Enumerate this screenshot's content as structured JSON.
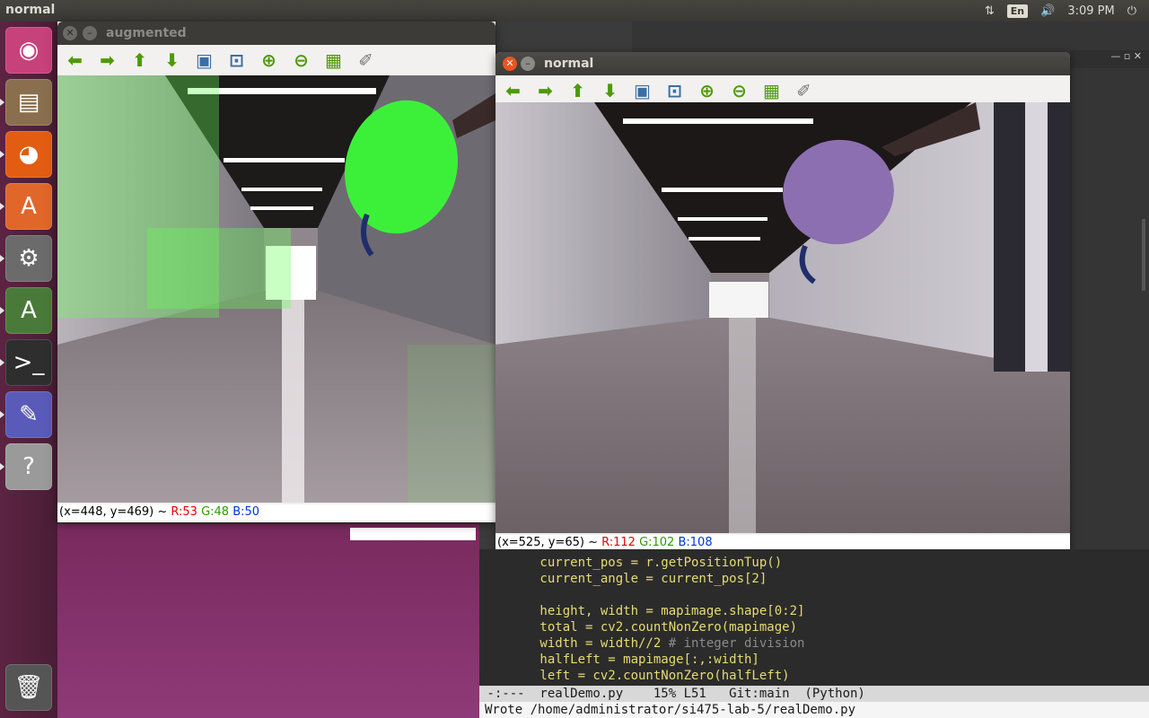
{
  "topbar": {
    "active_app": "normal",
    "lang": "En",
    "time": "3:09 PM",
    "network_icon": "network-arrows-icon",
    "volume_icon": "volume-icon",
    "power_icon": "power-icon"
  },
  "launcher": {
    "items": [
      {
        "name": "ubuntu-dash-icon",
        "glyph": "◉",
        "color": "#c7417a"
      },
      {
        "name": "files-icon",
        "glyph": "▤",
        "color": "#8a6f4e"
      },
      {
        "name": "firefox-icon",
        "glyph": "◕",
        "color": "#e25d12"
      },
      {
        "name": "software-center-icon",
        "glyph": "A",
        "color": "#e0662a"
      },
      {
        "name": "system-settings-icon",
        "glyph": "⚙",
        "color": "#6b6b6b"
      },
      {
        "name": "software-updater-icon",
        "glyph": "A",
        "color": "#4a7a3a"
      },
      {
        "name": "terminal-icon",
        "glyph": ">_",
        "color": "#2e2e2e"
      },
      {
        "name": "text-editor-icon",
        "glyph": "✎",
        "color": "#5a5ab8"
      },
      {
        "name": "help-icon",
        "glyph": "?",
        "color": "#9a9a9a"
      },
      {
        "name": "trash-icon",
        "glyph": "🗑",
        "color": "#555555"
      }
    ]
  },
  "augmented_window": {
    "title": "augmented",
    "status": {
      "coords": "(x=448, y=469) ~ ",
      "r": "R:53",
      "g": "G:48",
      "b": "B:50"
    }
  },
  "normal_window": {
    "title": "normal",
    "status": {
      "coords": "(x=525, y=65) ~ ",
      "r": "R:112",
      "g": "G:102",
      "b": "B:108"
    }
  },
  "toolbar_icons": [
    {
      "name": "pan-left-icon",
      "glyph": "⬅"
    },
    {
      "name": "pan-right-icon",
      "glyph": "➡"
    },
    {
      "name": "pan-up-icon",
      "glyph": "⬆"
    },
    {
      "name": "pan-down-icon",
      "glyph": "⬇"
    },
    {
      "name": "zoom-original-icon",
      "glyph": "▣"
    },
    {
      "name": "zoom-fit-icon",
      "glyph": "⊡"
    },
    {
      "name": "zoom-in-icon",
      "glyph": "⊕"
    },
    {
      "name": "zoom-out-icon",
      "glyph": "⊖"
    },
    {
      "name": "save-icon",
      "glyph": "▦"
    },
    {
      "name": "properties-icon",
      "glyph": "✐"
    }
  ],
  "editor": {
    "lines": [
      "        current_pos = r.getPositionTup()",
      "        current_angle = current_pos[2]",
      "",
      "        height, width = mapimage.shape[0:2]",
      "        total = cv2.countNonZero(mapimage)",
      "        width = width//2 # integer division",
      "        halfLeft = mapimage[:,:width]",
      "        left = cv2.countNonZero(halfLeft)"
    ],
    "modeline": " -:---  realDemo.py    15% L51   Git:main  (Python)",
    "minibuffer": "Wrote /home/administrator/si475-lab-5/realDemo.py"
  }
}
